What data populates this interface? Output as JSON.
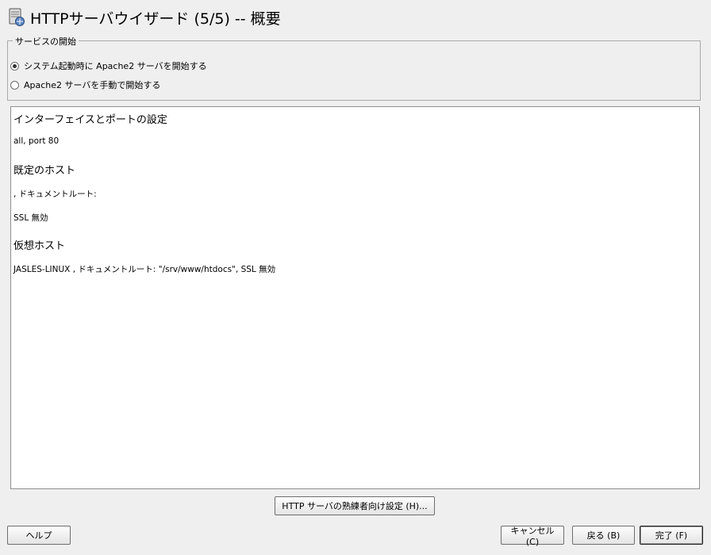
{
  "header": {
    "title": "HTTPサーバウイザード (5/5) -- 概要",
    "icon": "server-icon"
  },
  "service_start": {
    "legend": "サービスの開始",
    "options": [
      {
        "label": "システム起動時に Apache2 サーバを開始する",
        "selected": true
      },
      {
        "label": "Apache2 サーバを手動で開始する",
        "selected": false
      }
    ]
  },
  "summary": {
    "interface_heading": "インターフェイスとポートの設定",
    "interface_value": "all, port 80",
    "default_host_heading": "既定のホスト",
    "default_host_docroot": ", ドキュメントルート:",
    "default_host_ssl": "SSL 無効",
    "virtual_hosts_heading": "仮想ホスト",
    "virtual_host_entry": "JASLES-LINUX , ドキュメントルート: \"/srv/www/htdocs\", SSL 無効"
  },
  "buttons": {
    "expert": "HTTP サーバの熟練者向け設定 (H)...",
    "help": "ヘルプ",
    "cancel": "キャンセル (C)",
    "back": "戻る (B)",
    "finish": "完了 (F)"
  }
}
